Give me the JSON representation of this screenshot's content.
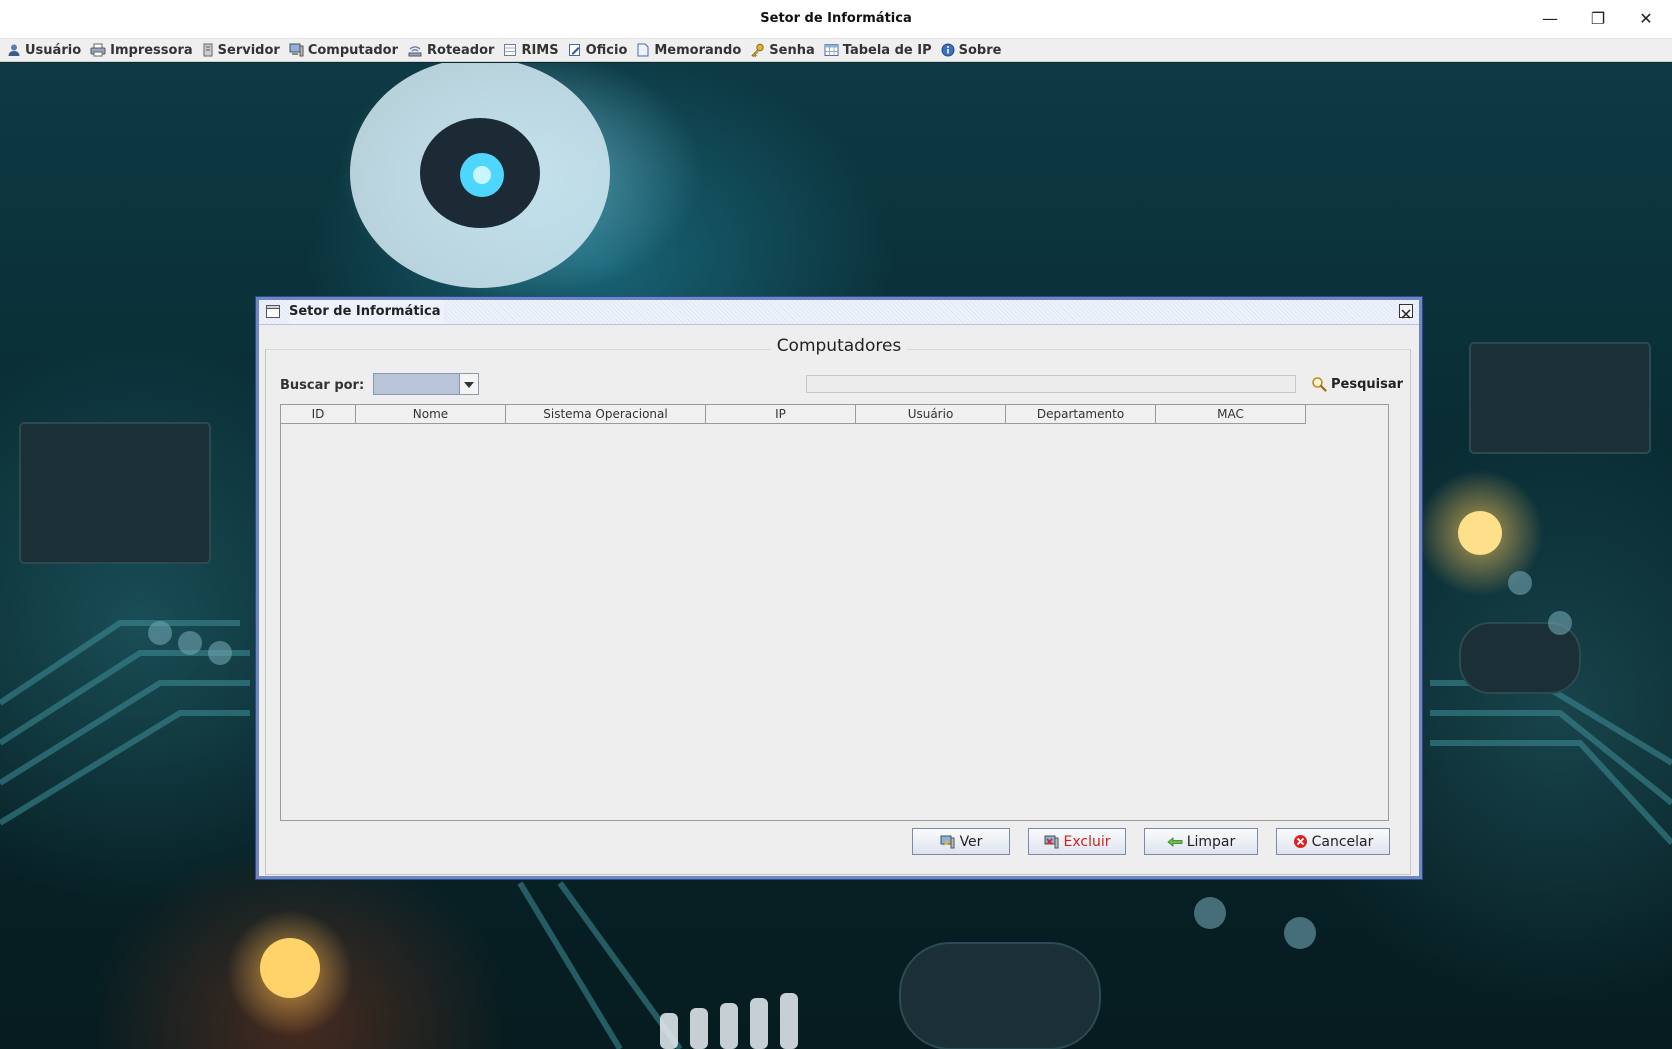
{
  "window": {
    "title": "Setor de Informática",
    "controls": {
      "minimize": "—",
      "maximize": "❐",
      "close": "✕"
    }
  },
  "menu": [
    {
      "label": "Usuário",
      "icon": "user-icon"
    },
    {
      "label": "Impressora",
      "icon": "printer-icon"
    },
    {
      "label": "Servidor",
      "icon": "server-icon"
    },
    {
      "label": "Computador",
      "icon": "computer-icon"
    },
    {
      "label": "Roteador",
      "icon": "router-icon"
    },
    {
      "label": "RIMS",
      "icon": "document-grid-icon"
    },
    {
      "label": "Oficio",
      "icon": "document-edit-icon"
    },
    {
      "label": "Memorando",
      "icon": "memo-icon"
    },
    {
      "label": "Senha",
      "icon": "key-icon"
    },
    {
      "label": "Tabela de IP",
      "icon": "table-icon"
    },
    {
      "label": "Sobre",
      "icon": "info-icon"
    }
  ],
  "frame": {
    "title": "Setor de Informática",
    "heading": "Computadores",
    "search": {
      "label": "Buscar por:",
      "selected": "",
      "value": "",
      "button_label": "Pesquisar"
    },
    "table": {
      "columns": [
        "ID",
        "Nome",
        "Sistema Operacional",
        "IP",
        "Usuário",
        "Departamento",
        "MAC"
      ],
      "rows": []
    },
    "buttons": {
      "ver": "Ver",
      "excluir": "Excluir",
      "limpar": "Limpar",
      "cancelar": "Cancelar"
    }
  },
  "colors": {
    "frame_border": "#6e86c4",
    "combo_fill": "#b9c4d8",
    "excluir_text": "#cc2222",
    "cancel_icon": "#dd2222"
  }
}
